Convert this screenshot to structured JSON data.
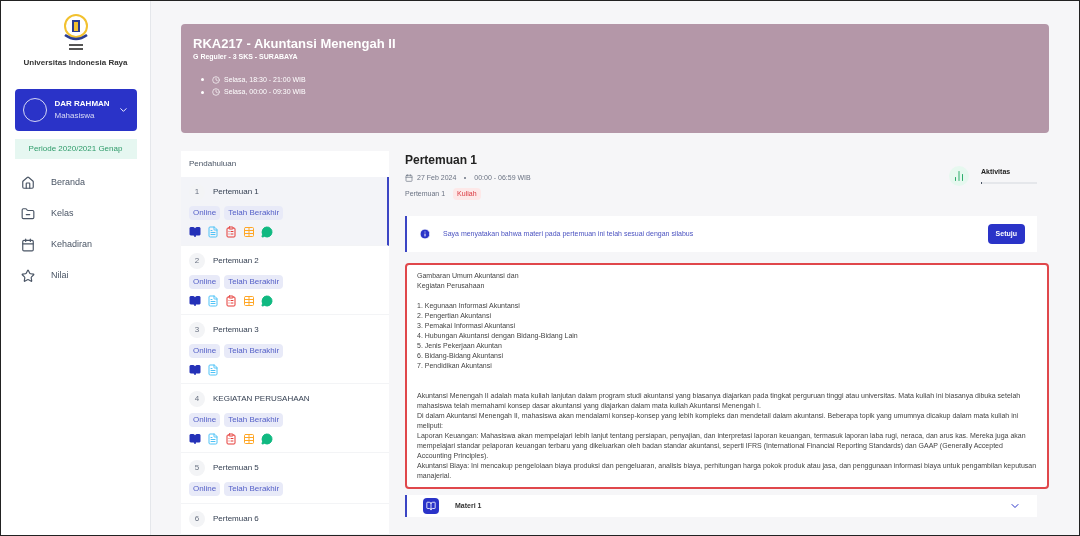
{
  "sidebar": {
    "university": "Universitas Indonesia Raya",
    "user": {
      "name": "DAR RAHMAN",
      "role": "Mahasiswa"
    },
    "period": "Periode 2020/2021 Genap",
    "nav": [
      {
        "kind": "home",
        "label": "Beranda",
        "selected": false
      },
      {
        "kind": "folder",
        "label": "Kelas",
        "selected": false
      },
      {
        "kind": "calendar",
        "label": "Kehadiran",
        "selected": false
      },
      {
        "kind": "star",
        "label": "Nilai",
        "selected": false
      }
    ]
  },
  "course": {
    "title": "RKA217 - Akuntansi Menengah II",
    "subtitle": "G Reguler - 3 SKS - SURABAYA",
    "schedules": [
      "Selasa, 18:30 - 21:00 WIB",
      "Selasa, 00:00 - 09:30 WIB"
    ]
  },
  "meetings_header": "Pendahuluan",
  "meetings": [
    {
      "number": "1",
      "title": "Pertemuan 1",
      "selected": true,
      "tags": [
        "Online",
        "Telah Berakhir"
      ],
      "materials": [
        {
          "kind": "book"
        },
        {
          "kind": "document"
        },
        {
          "kind": "assignment"
        },
        {
          "kind": "table"
        },
        {
          "kind": "chat"
        }
      ]
    },
    {
      "number": "2",
      "title": "Pertemuan 2",
      "selected": false,
      "tags": [
        "Online",
        "Telah Berakhir"
      ],
      "materials": [
        {
          "kind": "book"
        },
        {
          "kind": "document"
        },
        {
          "kind": "assignment"
        },
        {
          "kind": "table"
        },
        {
          "kind": "chat"
        }
      ]
    },
    {
      "number": "3",
      "title": "Pertemuan 3",
      "selected": false,
      "tags": [
        "Online",
        "Telah Berakhir"
      ],
      "materials": [
        {
          "kind": "book"
        },
        {
          "kind": "document"
        }
      ]
    },
    {
      "number": "4",
      "title": "KEGIATAN PERUSAHAAN",
      "selected": false,
      "tags": [
        "Online",
        "Telah Berakhir"
      ],
      "materials": [
        {
          "kind": "book"
        },
        {
          "kind": "document"
        },
        {
          "kind": "assignment"
        },
        {
          "kind": "table"
        },
        {
          "kind": "chat"
        }
      ]
    },
    {
      "number": "5",
      "title": "Pertemuan 5",
      "selected": false,
      "tags": [
        "Online",
        "Telah Berakhir"
      ]
    },
    {
      "number": "6",
      "title": "Pertemuan 6",
      "selected": false
    }
  ],
  "detail": {
    "title": "Pertemuan 1",
    "date": "27 Feb 2024",
    "time": "00:00 - 06:59 WIB",
    "label": "Pertemuan 1",
    "badge": "Kuliah",
    "activity": {
      "label": "Aktivitas",
      "level": 0.02
    },
    "notice": {
      "text": "Saya menyatakan bahwa materi pada pertemuan ini telah sesuai dengan silabus",
      "button": "Setuju"
    },
    "description": {
      "heading": [
        "Gambaran Umum Akuntansi dan",
        "Kegiatan Perusahaan"
      ],
      "items": [
        "1. Kegunaan Informasi Akuntansi",
        "2. Pengertian Akuntansi",
        "3. Pemakai Informasi Akuntansi",
        "4. Hubungan Akuntansi dengan Bidang-Bidang Lain",
        "5. Jenis Pekerjaan Akuntan",
        "6. Bidang-Bidang Akuntansi",
        "7. Pendidikan Akuntansi"
      ],
      "paragraphs": [
        "Akuntansi Menengah II adalah mata kuliah lanjutan dalam program studi akuntansi yang biasanya diajarkan pada tingkat perguruan tinggi atau universitas. Mata kuliah ini biasanya dibuka setelah mahasiswa telah memahami konsep dasar akuntansi yang diajarkan dalam mata kuliah Akuntansi Menengah I.",
        "Di dalam Akuntansi Menengah II, mahasiswa akan mendalami konsep-konsep yang lebih kompleks dan mendetail dalam akuntansi. Beberapa topik yang umumnya dicakup dalam mata kuliah ini meliputi:",
        "Laporan Keuangan: Mahasiswa akan mempelajari lebih lanjut tentang persiapan, penyajian, dan interpretasi laporan keuangan, termasuk laporan laba rugi, neraca, dan arus kas. Mereka juga akan mempelajari standar pelaporan keuangan terbaru yang dikeluarkan oleh badan standar akuntansi, seperti IFRS (International Financial Reporting Standards) dan GAAP (Generally Accepted Accounting Principles).",
        "Akuntansi Biaya: Ini mencakup pengelolaan biaya produksi dan pengeluaran, analisis biaya, perhitungan harga pokok produk atau jasa, dan penggunaan informasi biaya untuk pengambilan keputusan manajerial."
      ]
    },
    "materials": [
      {
        "title": "Materi 1",
        "expanded": false
      }
    ]
  }
}
